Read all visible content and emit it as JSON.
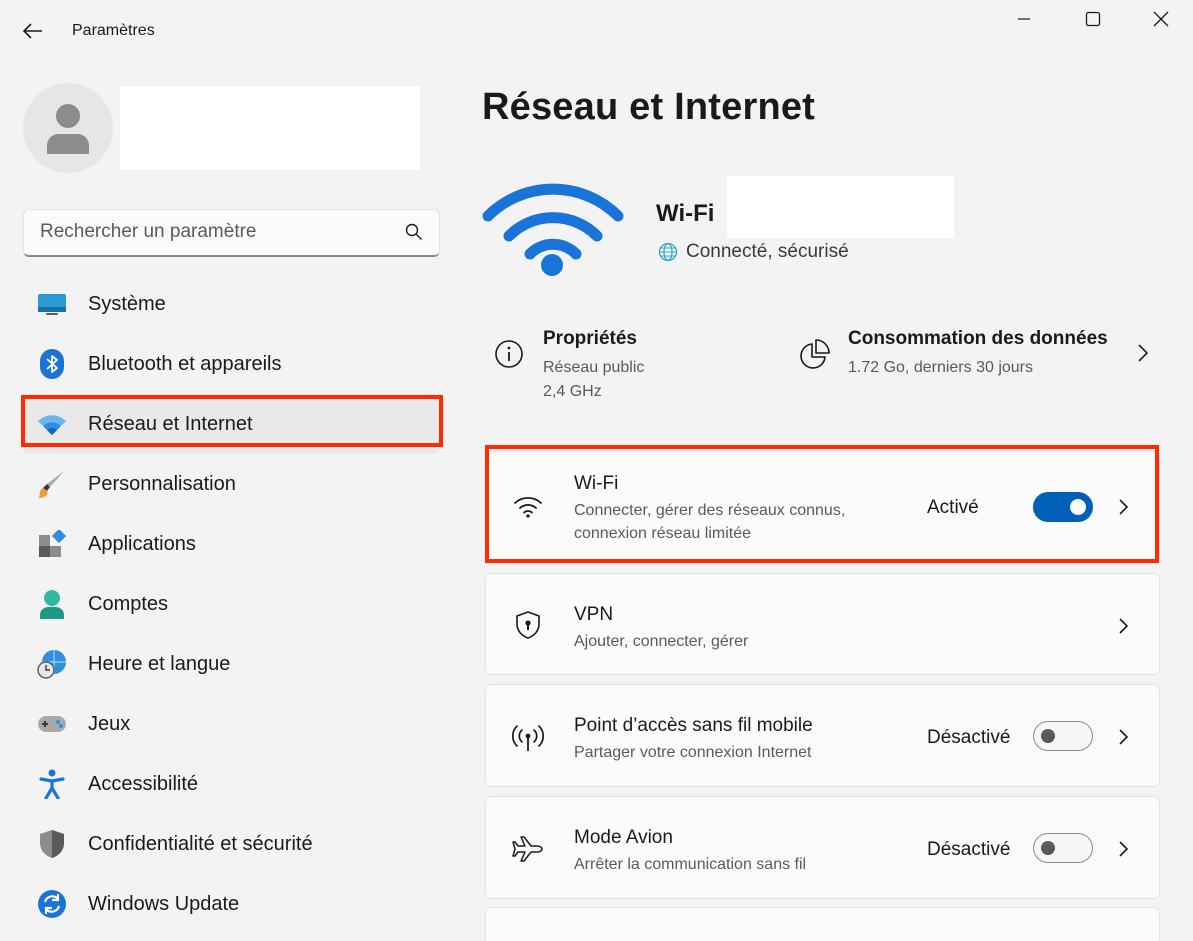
{
  "window": {
    "title": "Paramètres",
    "back_icon": "back-arrow-icon",
    "controls": [
      "minimize-icon",
      "maximize-icon",
      "close-icon"
    ]
  },
  "profile": {
    "avatar_icon": "user-avatar-icon"
  },
  "search": {
    "placeholder": "Rechercher un paramètre",
    "value": "",
    "icon": "search-icon"
  },
  "sidebar": {
    "selected_index": 2,
    "items": [
      {
        "label": "Système",
        "icon": "system-icon"
      },
      {
        "label": "Bluetooth et appareils",
        "icon": "bluetooth-icon"
      },
      {
        "label": "Réseau et Internet",
        "icon": "wifi-network-icon"
      },
      {
        "label": "Personnalisation",
        "icon": "paintbrush-icon"
      },
      {
        "label": "Applications",
        "icon": "apps-icon"
      },
      {
        "label": "Comptes",
        "icon": "account-icon"
      },
      {
        "label": "Heure et langue",
        "icon": "clock-globe-icon"
      },
      {
        "label": "Jeux",
        "icon": "gamepad-icon"
      },
      {
        "label": "Accessibilité",
        "icon": "accessibility-icon"
      },
      {
        "label": "Confidentialité et sécurité",
        "icon": "shield-icon"
      },
      {
        "label": "Windows Update",
        "icon": "windows-update-icon"
      }
    ]
  },
  "main": {
    "title": "Réseau et Internet",
    "connection": {
      "name": "Wi-Fi",
      "status": "Connecté, sécurisé"
    },
    "properties": {
      "title": "Propriétés",
      "line1": "Réseau public",
      "line2": "2,4 GHz"
    },
    "data_usage": {
      "title": "Consommation des données",
      "subtitle": "1.72 Go, derniers 30 jours"
    },
    "cards": {
      "wifi": {
        "title": "Wi-Fi",
        "subtitle_line1": "Connecter, gérer des réseaux connus,",
        "subtitle_line2": "connexion réseau limitée",
        "state": "Activé",
        "toggle_on": true
      },
      "vpn": {
        "title": "VPN",
        "subtitle": "Ajouter, connecter, gérer"
      },
      "hotspot": {
        "title": "Point d’accès sans fil mobile",
        "subtitle": "Partager votre connexion Internet",
        "state": "Désactivé",
        "toggle_on": false
      },
      "airplane": {
        "title": "Mode Avion",
        "subtitle": "Arrêter la communication sans fil",
        "state": "Désactivé",
        "toggle_on": false
      }
    }
  },
  "colors": {
    "accent": "#005fb8",
    "highlight_box": "#ff2a00",
    "background": "#f3f3f3",
    "card": "#fbfbfb"
  }
}
